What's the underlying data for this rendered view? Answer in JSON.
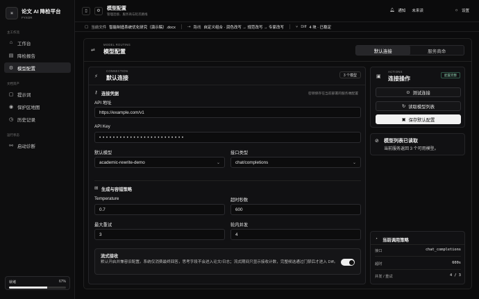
{
  "brand": {
    "title": "论文 AI 降检平台",
    "sub": "FYXOR"
  },
  "sidebar": {
    "sec1": "主工作流",
    "sec2": "文档资产",
    "sec3": "运行状态",
    "items": [
      {
        "icon": "⌂",
        "label": "工作台"
      },
      {
        "icon": "▤",
        "label": "降检报告"
      },
      {
        "icon": "⚙",
        "label": "模型配置"
      },
      {
        "icon": "▢",
        "label": "提示词"
      },
      {
        "icon": "◉",
        "label": "保护区地图"
      },
      {
        "icon": "◷",
        "label": "历史记录"
      },
      {
        "icon": "⚯",
        "label": "启动诊断"
      }
    ],
    "status": {
      "label": "就绪",
      "percent": "67%",
      "progress": 0.67
    }
  },
  "header": {
    "title": "模型配置",
    "sub": "管理连接、服务商与轮次路线",
    "notify": "通知",
    "user": "未来读",
    "settings": "设置"
  },
  "pathbar": {
    "file_label": "当前文件",
    "file": "智能制造系统优化研究（演示稿）.docx",
    "route_label": "路线",
    "route": "自定义组合 · 润色改写 → 规范改写 → 专家改写",
    "diff_label": "Diff",
    "diff": "4 块 · 已稳定"
  },
  "main": {
    "cap": "MODEL ROUTING",
    "title": "模型配置",
    "tabs": [
      "默认连接",
      "服务商命"
    ]
  },
  "conn": {
    "cap": "CONNECTION",
    "title": "默认连接",
    "badge": "3 个模型",
    "cred_title": "连接凭据",
    "cred_note": "密钥保存在当前部署的服务端配置",
    "api_label": "API 地址",
    "api_value": "https://example.com/v1",
    "key_label": "API Key",
    "key_value": "• • • • • • • • • • • • • • • • • • • • • • • • •",
    "model_label": "默认模型",
    "model_value": "academic-rewrite-demo",
    "iface_label": "接口类型",
    "iface_value": "chat/completions",
    "gen_title": "生成与容错策略",
    "temp_label": "Temperature",
    "temp_value": "0.7",
    "timeout_label": "超时秒数",
    "timeout_value": "600",
    "retry_label": "最大重试",
    "retry_value": "3",
    "conc_label": "轮内并发",
    "conc_value": "4",
    "stream_title": "流式接收",
    "stream_desc": "默认开启并兼容旧配置。系统仅消费最终回答，思考字段不会进入论文/日志；流式期间只显示接收计数，完整候选通过门禁后才进入 Diff。"
  },
  "actions": {
    "cap": "ACTIONS",
    "title": "连接操作",
    "badge": "配置完整",
    "test": "测试连接",
    "fetch": "读取模型列表",
    "save": "保存默认配置"
  },
  "result": {
    "title": "模型列表已读取",
    "desc": "当前服务返回 3 个可用模型。"
  },
  "policy": {
    "title": "当前调用策略",
    "rows": [
      {
        "k": "接口",
        "v": "chat_completions"
      },
      {
        "k": "超时",
        "v": "600s"
      },
      {
        "k": "并发 / 重试",
        "v": "4 / 3"
      }
    ]
  }
}
